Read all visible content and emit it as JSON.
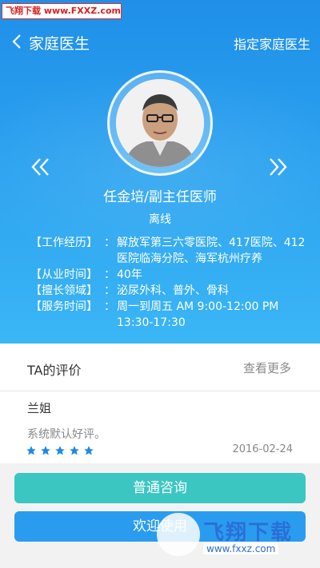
{
  "watermark_top": "飞翔下载 www.FXXZ.com",
  "nav": {
    "title": "家庭医生",
    "right_action": "指定家庭医生"
  },
  "doctor": {
    "name_title": "任金培/副主任医师",
    "status": "离线",
    "info": [
      {
        "label": "【工作经历】",
        "colon": "：",
        "value": "解放军第三六零医院、417医院、412医院临海分院、海军杭州疗养"
      },
      {
        "label": "【从业时间】",
        "colon": "：",
        "value": "40年"
      },
      {
        "label": "【擅长领域】",
        "colon": "：",
        "value": "泌尿外科、普外、骨科"
      },
      {
        "label": "【服务时间】",
        "colon": "：",
        "value": "周一到周五 AM 9:00-12:00 PM 13:30-17:30"
      }
    ]
  },
  "reviews": {
    "title": "TA的评价",
    "more": "查看更多",
    "item": {
      "user": "兰姐",
      "text": "系统默认好评。",
      "rating": 5,
      "date": "2016-02-24"
    }
  },
  "buttons": {
    "consult": "普通咨询",
    "welcome": "欢迎使用"
  },
  "watermark_bottom": {
    "text": "飞翔下载",
    "url": "www.fxxz.com"
  },
  "colors": {
    "hero_top": "#1f8fe8",
    "hero_bottom": "#3bb6f6",
    "green_button": "#3cc6c1",
    "blue_button": "#2a9cf0",
    "star": "#1e88e5"
  }
}
